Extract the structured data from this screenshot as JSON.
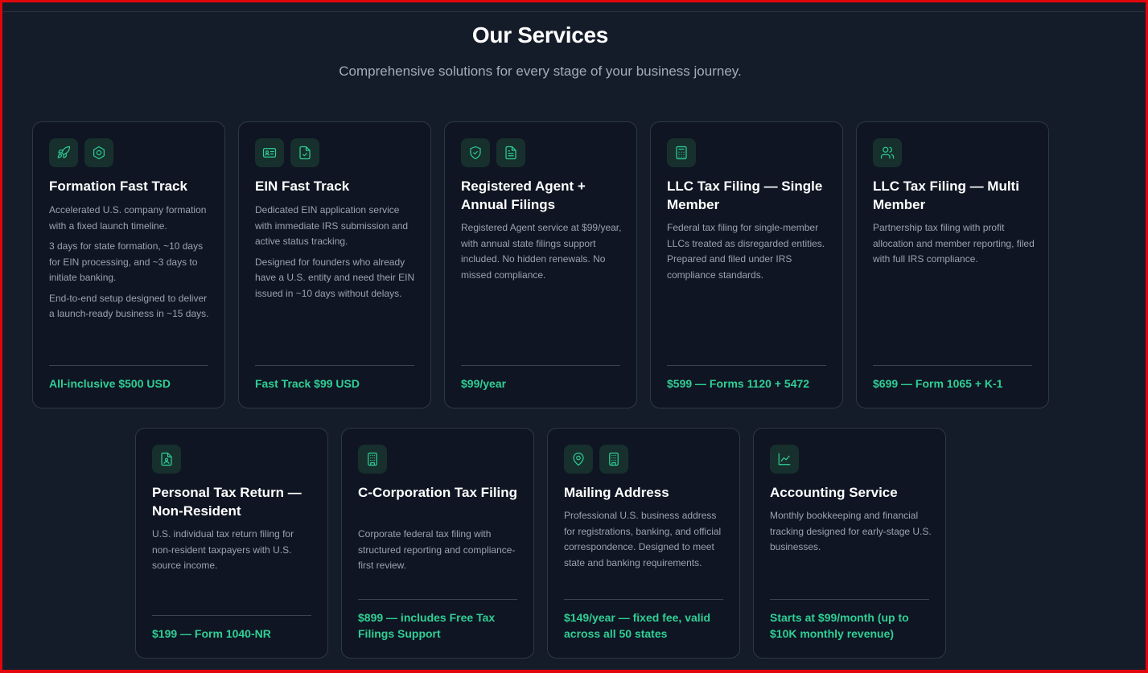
{
  "header": {
    "title": "Our Services",
    "subtitle": "Comprehensive solutions for every stage of your business journey."
  },
  "colors": {
    "background": "#151c29",
    "card": "#0f1522",
    "accent": "#2fcf95",
    "frame": "#e1060b"
  },
  "services": [
    {
      "icons": [
        "rocket-icon",
        "hexagon-nut-icon"
      ],
      "title": "Formation Fast Track",
      "body": [
        "Accelerated U.S. company formation with a fixed launch timeline.",
        "3 days for state formation, ~10 days for EIN processing, and ~3 days to initiate banking.",
        "End-to-end setup designed to deliver a launch-ready business in ~15 days."
      ],
      "price": "All-inclusive $500 USD"
    },
    {
      "icons": [
        "id-card-icon",
        "file-check-icon"
      ],
      "title": "EIN Fast Track",
      "body": [
        "Dedicated EIN application service with immediate IRS submission and active status tracking.",
        "Designed for founders who already have a U.S. entity and need their EIN issued in ~10 days without delays."
      ],
      "price": "Fast Track $99 USD"
    },
    {
      "icons": [
        "shield-check-icon",
        "document-icon"
      ],
      "title": "Registered Agent + Annual Filings",
      "body": [
        "Registered Agent service at $99/year, with annual state filings support included. No hidden renewals. No missed compliance."
      ],
      "price": "$99/year"
    },
    {
      "icons": [
        "calculator-icon"
      ],
      "title": "LLC Tax Filing — Single Member",
      "body": [
        "Federal tax filing for single-member LLCs treated as disregarded entities. Prepared and filed under IRS compliance standards."
      ],
      "price": "$599 — Forms 1120 + 5472"
    },
    {
      "icons": [
        "users-icon"
      ],
      "title": "LLC Tax Filing — Multi Member",
      "body": [
        "Partnership tax filing with profit allocation and member reporting, filed with full IRS compliance."
      ],
      "price": "$699 — Form 1065 + K-1"
    },
    {
      "icons": [
        "file-user-icon"
      ],
      "title": "Personal Tax Return — Non-Resident",
      "body": [
        "U.S. individual tax return filing for non-resident taxpayers with U.S. source income."
      ],
      "price": "$199 — Form 1040-NR"
    },
    {
      "icons": [
        "building-icon"
      ],
      "title": "C-Corporation Tax Filing",
      "body": [
        "Corporate federal tax filing with structured reporting and compliance-first review."
      ],
      "price": "$899 — includes Free Tax Filings Support"
    },
    {
      "icons": [
        "map-pin-icon",
        "building-icon"
      ],
      "title": "Mailing Address",
      "body": [
        "Professional U.S. business address for registrations, banking, and official correspondence. Designed to meet state and banking requirements."
      ],
      "price": "$149/year — fixed fee, valid across all 50 states"
    },
    {
      "icons": [
        "line-chart-icon"
      ],
      "title": "Accounting Service",
      "body": [
        "Monthly bookkeeping and financial tracking designed for early-stage U.S. businesses."
      ],
      "price": "Starts at $99/month (up to $10K monthly revenue)"
    }
  ]
}
